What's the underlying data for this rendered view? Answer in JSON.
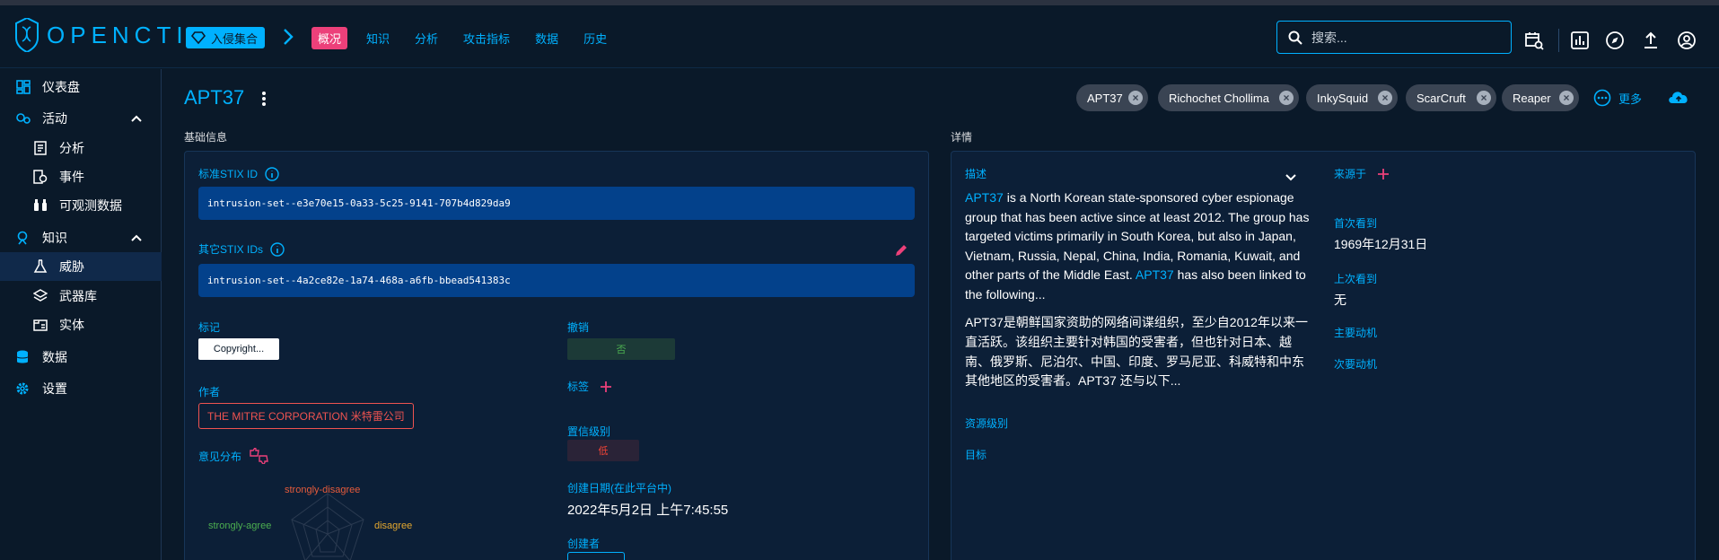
{
  "app": {
    "logo_text": "OPENCTI"
  },
  "topbar": {
    "entity_type_badge": "入侵集合",
    "tabs": [
      {
        "label": "概况",
        "active": true
      },
      {
        "label": "知识",
        "active": false
      },
      {
        "label": "分析",
        "active": false
      },
      {
        "label": "攻击指标",
        "active": false
      },
      {
        "label": "数据",
        "active": false
      },
      {
        "label": "历史",
        "active": false
      }
    ],
    "search_placeholder": "搜索..."
  },
  "sidebar": {
    "dashboard": "仪表盘",
    "activities": "活动",
    "analysis": "分析",
    "events": "事件",
    "observations": "可观测数据",
    "knowledge": "知识",
    "threats": "威胁",
    "arsenal": "武器库",
    "entities": "实体",
    "data": "数据",
    "settings": "设置"
  },
  "entity": {
    "title": "APT37",
    "aliases": [
      "APT37",
      "Richochet Chollima",
      "InkySquid",
      "ScarCruft",
      "Reaper"
    ],
    "more_label": "更多"
  },
  "basic": {
    "section_label": "基础信息",
    "stix_id_label": "标准STIX ID",
    "stix_id": "intrusion-set--e3e70e15-0a33-5c25-9141-707b4d829da9",
    "other_ids_label": "其它STIX IDs",
    "other_id": "intrusion-set--4a2ce82e-1a74-468a-a6fb-bbead541383c",
    "marking_label": "标记",
    "marking_value": "Copyright...",
    "revoked_label": "撤销",
    "revoked_value": "否",
    "labels_label": "标签",
    "author_label": "作者",
    "author_value": "THE MITRE CORPORATION 米特雷公司",
    "confidence_label": "置信级别",
    "confidence_value": "低",
    "opinion_label": "意见分布",
    "created_label": "创建日期(在此平台中)",
    "created_value": "2022年5月2日 上午7:45:55",
    "creator_label": "创建者",
    "radar_axes": [
      "strongly-disagree",
      "disagree",
      "strongly-agree"
    ],
    "colors": {
      "strongly_disagree": "#e65b3b",
      "disagree": "#e3a72f",
      "strongly_agree": "#4caf50"
    }
  },
  "details": {
    "section_label": "详情",
    "description_label": "描述",
    "description_en": {
      "link1": "APT37",
      "text1": " is a North Korean state-sponsored cyber espionage group that has been active since at least 2012. The group has targeted victims primarily in South Korea, but also in Japan, Vietnam, Russia, Nepal, China, India, Romania, Kuwait, and other parts of the Middle East. ",
      "link2": "APT37",
      "text2": " has also been linked to the following..."
    },
    "description_cn": "APT37是朝鲜国家资助的网络间谍组织，至少自2012年以来一直活跃。该组织主要针对韩国的受害者，但也针对日本、越南、俄罗斯、尼泊尔、中国、印度、罗马尼亚、科威特和中东其他地区的受害者。APT37 还与以下...",
    "resource_level_label": "资源级别",
    "goals_label": "目标",
    "sourced_from_label": "来源于",
    "first_seen_label": "首次看到",
    "first_seen_value": "1969年12月31日",
    "last_seen_label": "上次看到",
    "last_seen_value": "无",
    "primary_motivation_label": "主要动机",
    "secondary_motivation_label": "次要动机"
  }
}
